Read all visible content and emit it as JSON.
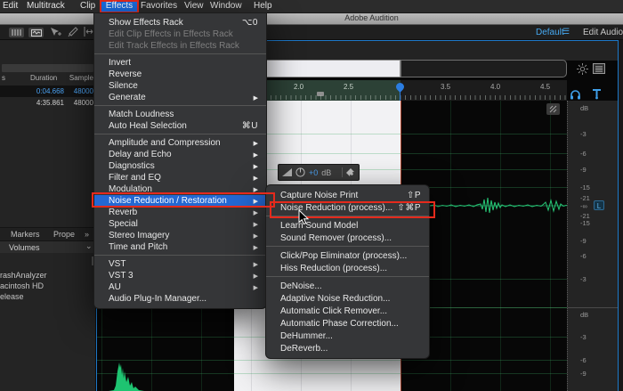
{
  "menubar": {
    "items": [
      "Edit",
      "Multitrack",
      "Clip",
      "Effects",
      "Favorites",
      "View",
      "Window",
      "Help"
    ],
    "highlighted_item": "Effects"
  },
  "titlebar": {
    "title": "Adobe Audition"
  },
  "toolbar": {
    "workspace_label": "Default",
    "right_label": "Edit Audio to"
  },
  "files_panel": {
    "header": {
      "col_fragment": "s",
      "duration": "Duration",
      "sample": "Sample"
    },
    "rows": [
      {
        "duration": "0:04.668",
        "sample": "48000",
        "selected": true
      },
      {
        "duration": "4:35.861",
        "sample": "48000",
        "selected": false
      }
    ],
    "tabs": {
      "markers": "Markers",
      "properties": "Prope",
      "overflow": "»"
    },
    "volumes": {
      "label": "Volumes",
      "chevron": "⌄",
      "items": [
        "rashAnalyzer",
        "acintosh HD",
        "elease"
      ]
    }
  },
  "effects_menu": {
    "items": [
      {
        "label": "Show Effects Rack",
        "shortcut": "⌥0"
      },
      {
        "label": "Edit Clip Effects in Effects Rack"
      },
      {
        "label": "Edit Track Effects in Effects Rack"
      },
      {
        "label": "Invert"
      },
      {
        "label": "Reverse"
      },
      {
        "label": "Silence"
      },
      {
        "label": "Generate"
      },
      {
        "label": "Match Loudness"
      },
      {
        "label": "Auto Heal Selection",
        "shortcut": "⌘U"
      },
      {
        "label": "Amplitude and Compression"
      },
      {
        "label": "Delay and Echo"
      },
      {
        "label": "Diagnostics"
      },
      {
        "label": "Filter and EQ"
      },
      {
        "label": "Modulation"
      },
      {
        "label": "Noise Reduction / Restoration"
      },
      {
        "label": "Reverb"
      },
      {
        "label": "Special"
      },
      {
        "label": "Stereo Imagery"
      },
      {
        "label": "Time and Pitch"
      },
      {
        "label": "VST"
      },
      {
        "label": "VST 3"
      },
      {
        "label": "AU"
      },
      {
        "label": "Audio Plug-In Manager..."
      }
    ]
  },
  "noise_submenu": {
    "items": [
      {
        "label": "Capture Noise Print",
        "shortcut": "⇧P"
      },
      {
        "label": "Noise Reduction (process)...",
        "shortcut": "⇧⌘P"
      },
      {
        "label": "Learn Sound Model"
      },
      {
        "label": "Sound Remover (process)..."
      },
      {
        "label": "Click/Pop Eliminator (process)..."
      },
      {
        "label": "Hiss Reduction (process)..."
      },
      {
        "label": "DeNoise..."
      },
      {
        "label": "Adaptive Noise Reduction..."
      },
      {
        "label": "Automatic Click Remover..."
      },
      {
        "label": "Automatic Phase Correction..."
      },
      {
        "label": "DeHummer..."
      },
      {
        "label": "DeReverb..."
      }
    ]
  },
  "editor": {
    "ruler_labels": [
      "2.0",
      "2.5",
      "3.5",
      "4.0",
      "4.5"
    ],
    "hud": {
      "gain": "+0",
      "unit": "dB"
    },
    "db_scale": {
      "unit_label": "dB",
      "left_labels": [
        "-3",
        "-6",
        "-9",
        "-15",
        "-21",
        "-∞",
        "-21",
        "-15",
        "-9",
        "-6",
        "-3"
      ],
      "right_channel_labels": [
        "dB",
        "-3",
        "-6",
        "-9"
      ],
      "channel_badge": "L"
    }
  },
  "icons": {
    "submenu_arrow": "▶",
    "hamburger": "☰"
  },
  "colors": {
    "annotation_red": "#e52a1c",
    "menu_highlight_blue": "#2468d3",
    "menubar_highlight_blue": "#1a6ce0",
    "playhead_blue": "#2b7de0",
    "waveform_green": "#22c374",
    "selection_white": "#f2f2f4",
    "workspace_link_blue": "#46a8f0",
    "file_selected_blue": "#4aa0f0",
    "panel_border_blue": "#1d78c8"
  }
}
